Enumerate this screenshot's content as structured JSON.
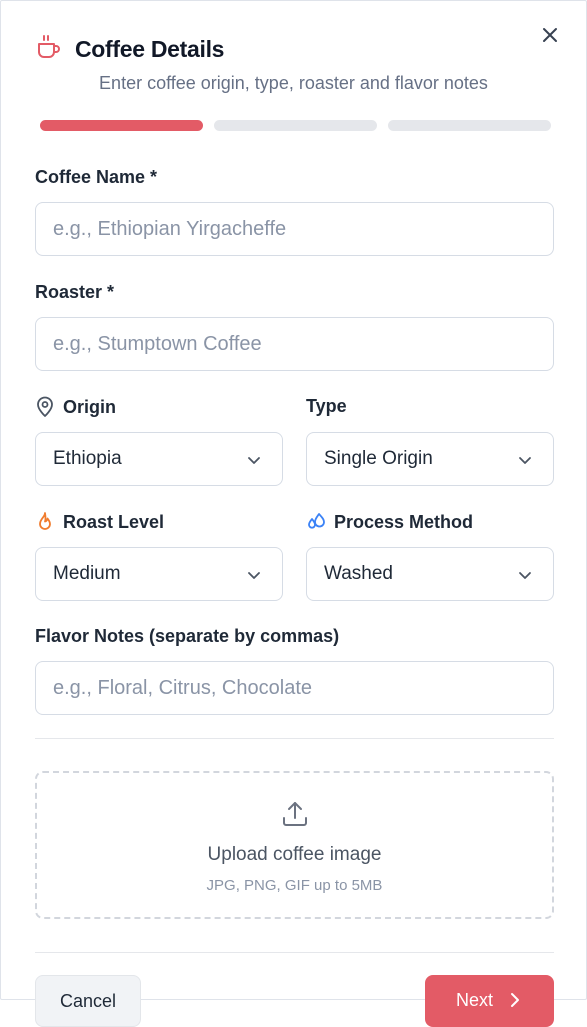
{
  "header": {
    "title": "Coffee Details",
    "subtitle": "Enter coffee origin, type, roaster and flavor notes",
    "icon": "coffee-cup-icon",
    "accent": "#e35b66"
  },
  "steps": {
    "current": 1,
    "total": 3
  },
  "fields": {
    "coffee_name": {
      "label": "Coffee Name *",
      "placeholder": "e.g., Ethiopian Yirgacheffe"
    },
    "roaster": {
      "label": "Roaster *",
      "placeholder": "e.g., Stumptown Coffee"
    },
    "origin": {
      "label": "Origin",
      "value": "Ethiopia",
      "icon": "map-pin-icon"
    },
    "type": {
      "label": "Type",
      "value": "Single Origin"
    },
    "roast_level": {
      "label": "Roast Level",
      "value": "Medium",
      "icon": "flame-icon"
    },
    "process_method": {
      "label": "Process Method",
      "value": "Washed",
      "icon": "droplets-icon"
    },
    "flavor_notes": {
      "label": "Flavor Notes (separate by commas)",
      "placeholder": "e.g., Floral, Citrus, Chocolate"
    }
  },
  "upload": {
    "title": "Upload coffee image",
    "hint": "JPG, PNG, GIF up to 5MB",
    "icon": "upload-icon"
  },
  "footer": {
    "cancel_label": "Cancel",
    "next_label": "Next"
  }
}
